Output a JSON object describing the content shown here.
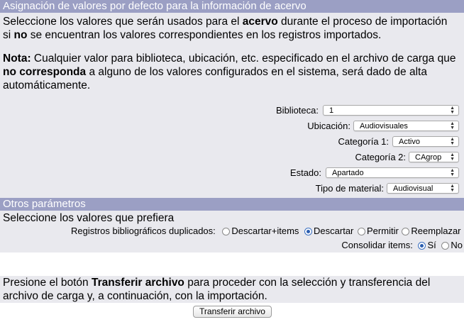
{
  "section1": {
    "title": "Asignación de valores por defecto para la información de acervo",
    "intro": {
      "part1": "Seleccione los valores que serán usados para el ",
      "bold1": "acervo",
      "part2": " durante el proceso de importación si ",
      "bold2": "no",
      "part3": " se encuentran los valores correspondientes en los registros importados."
    },
    "note": {
      "bold_label": "Nota:",
      "part1": " Cualquier valor para biblioteca, ubicación, etc. especificado en el archivo de carga que ",
      "bold1": "no corresponda",
      "part2": " a alguno de los valores configurados en el sistema, será dado de alta automáticamente."
    },
    "fields": {
      "biblioteca": {
        "label": "Biblioteca:",
        "value": "1"
      },
      "ubicacion": {
        "label": "Ubicación:",
        "value": "Audiovisuales"
      },
      "categoria1": {
        "label": "Categoría 1:",
        "value": "Activo"
      },
      "categoria2": {
        "label": "Categoría 2:",
        "value": "CAgrop"
      },
      "estado": {
        "label": "Estado:",
        "value": "Apartado"
      },
      "tipo_material": {
        "label": "Tipo de material:",
        "value": "Audiovisual"
      }
    }
  },
  "section2": {
    "title": "Otros parámetros",
    "intro": "Seleccione los valores que prefiera",
    "duplicados": {
      "label": "Registros bibliográficos duplicados:",
      "options": [
        "Descartar+items",
        "Descartar",
        "Permitir",
        "Reemplazar"
      ],
      "selected": "Descartar"
    },
    "consolidar": {
      "label": "Consolidar items:",
      "options": [
        "Sí",
        "No"
      ],
      "selected": "Sí"
    }
  },
  "footer": {
    "part1": "Presione el botón ",
    "bold1": "Transferir archivo",
    "part2": " para proceder con la selección y transferencia del archivo de carga y, a continuación, con la importación.",
    "button_label": "Transferir archivo"
  },
  "colors": {
    "header_bg": "#9b9fc4",
    "panel_bg": "#e9e9ee",
    "radio_selected": "#2a5db0"
  }
}
